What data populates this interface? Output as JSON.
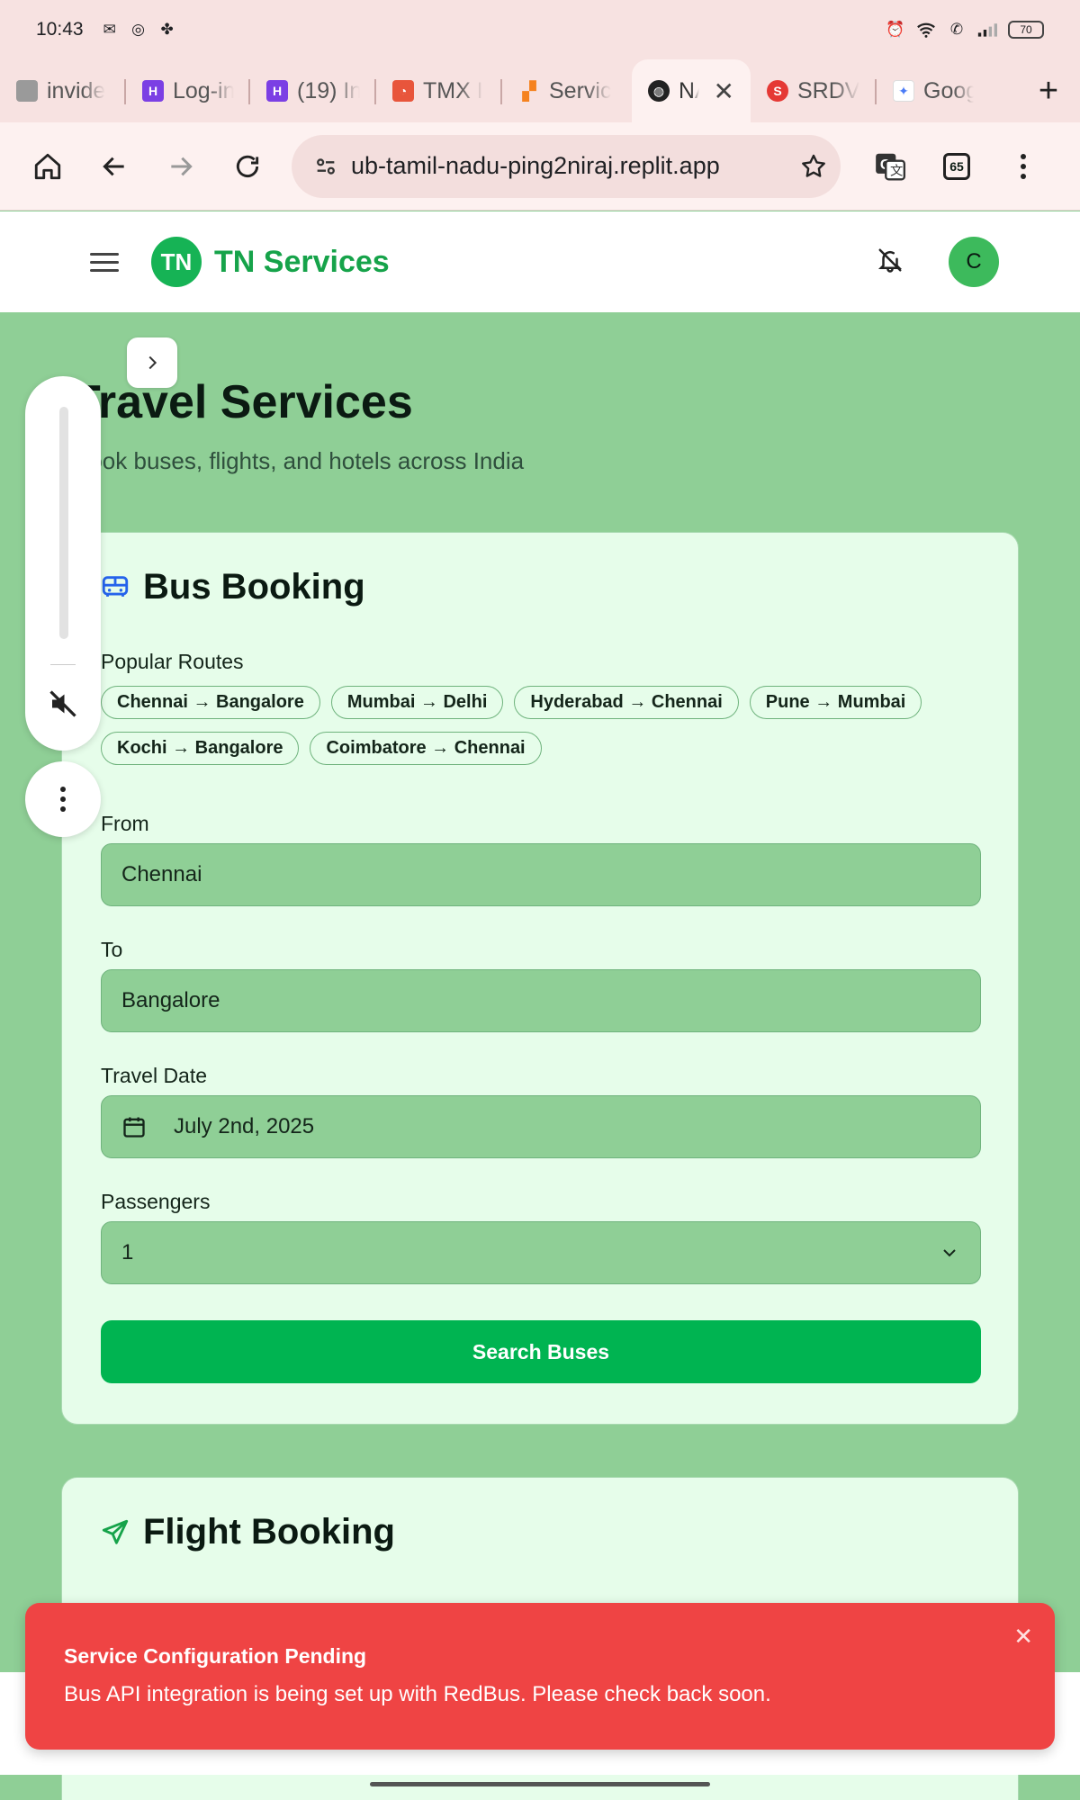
{
  "status": {
    "time": "10:43",
    "battery": "70"
  },
  "tabs": [
    {
      "title": "invide",
      "favicon_color": "#9a9a9a"
    },
    {
      "title": "Log-in",
      "favicon_color": "#7b3fe4"
    },
    {
      "title": "(19) In",
      "favicon_color": "#7b3fe4"
    },
    {
      "title": "TMX I",
      "favicon_color": "#e8553b"
    },
    {
      "title": "Servic",
      "favicon_color": "#f5821f"
    },
    {
      "title": "NA",
      "favicon_color": "#222222",
      "active": true
    },
    {
      "title": "SRDV",
      "favicon_color": "#e53935"
    },
    {
      "title": "Goog",
      "favicon_color": "#4a7bf7"
    }
  ],
  "toolbar": {
    "url": "ub-tamil-nadu-ping2niraj.replit.app",
    "tab_count": "65"
  },
  "header": {
    "logo_text": "TN",
    "brand": "TN Services",
    "avatar_initial": "C"
  },
  "page": {
    "title": "Travel Services",
    "subtitle": "Book buses, flights, and hotels across India"
  },
  "bus": {
    "heading": "Bus Booking",
    "popular_label": "Popular Routes",
    "routes": [
      "Chennai → Bangalore",
      "Mumbai → Delhi",
      "Hyderabad → Chennai",
      "Pune → Mumbai",
      "Kochi → Bangalore",
      "Coimbatore → Chennai"
    ],
    "from_label": "From",
    "from_value": "Chennai",
    "to_label": "To",
    "to_value": "Bangalore",
    "date_label": "Travel Date",
    "date_value": "July 2nd, 2025",
    "passengers_label": "Passengers",
    "passengers_value": "1",
    "search_button": "Search Buses"
  },
  "flight": {
    "heading": "Flight Booking"
  },
  "toast": {
    "title": "Service Configuration Pending",
    "message": "Bus API integration is being set up with RedBus. Please check back soon."
  },
  "colors": {
    "brand": "#16a34a",
    "primary_button": "#00b451",
    "toast": "#ef4444",
    "page_bg": "#8fcf96",
    "card_bg": "#e6fdea"
  }
}
